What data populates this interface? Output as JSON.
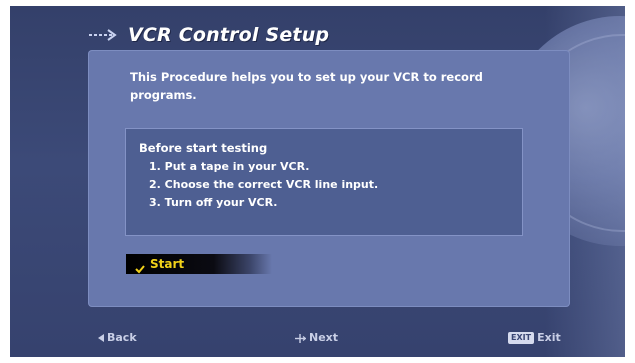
{
  "screen": {
    "title": "VCR Control Setup",
    "intro_text": "This Procedure helps you to set up your VCR to record programs."
  },
  "instructions": {
    "heading": "Before start testing",
    "steps": [
      "1. Put a tape in your VCR.",
      "2. Choose the correct VCR line input.",
      "3. Turn off your VCR."
    ]
  },
  "start_button": {
    "label": "Start",
    "icon": "check-icon",
    "selected": true
  },
  "footer": {
    "back_label": "Back",
    "back_icon": "triangle-left-icon",
    "next_label": "Next",
    "next_icon": "cross-arrow-icon",
    "exit_key": "EXIT",
    "exit_label": "Exit"
  },
  "colors": {
    "background": "#3a4674",
    "panel": "#6878ad",
    "instructions_box": "#4e5f92",
    "highlight_text": "#f2d21a",
    "text": "#ffffff"
  }
}
